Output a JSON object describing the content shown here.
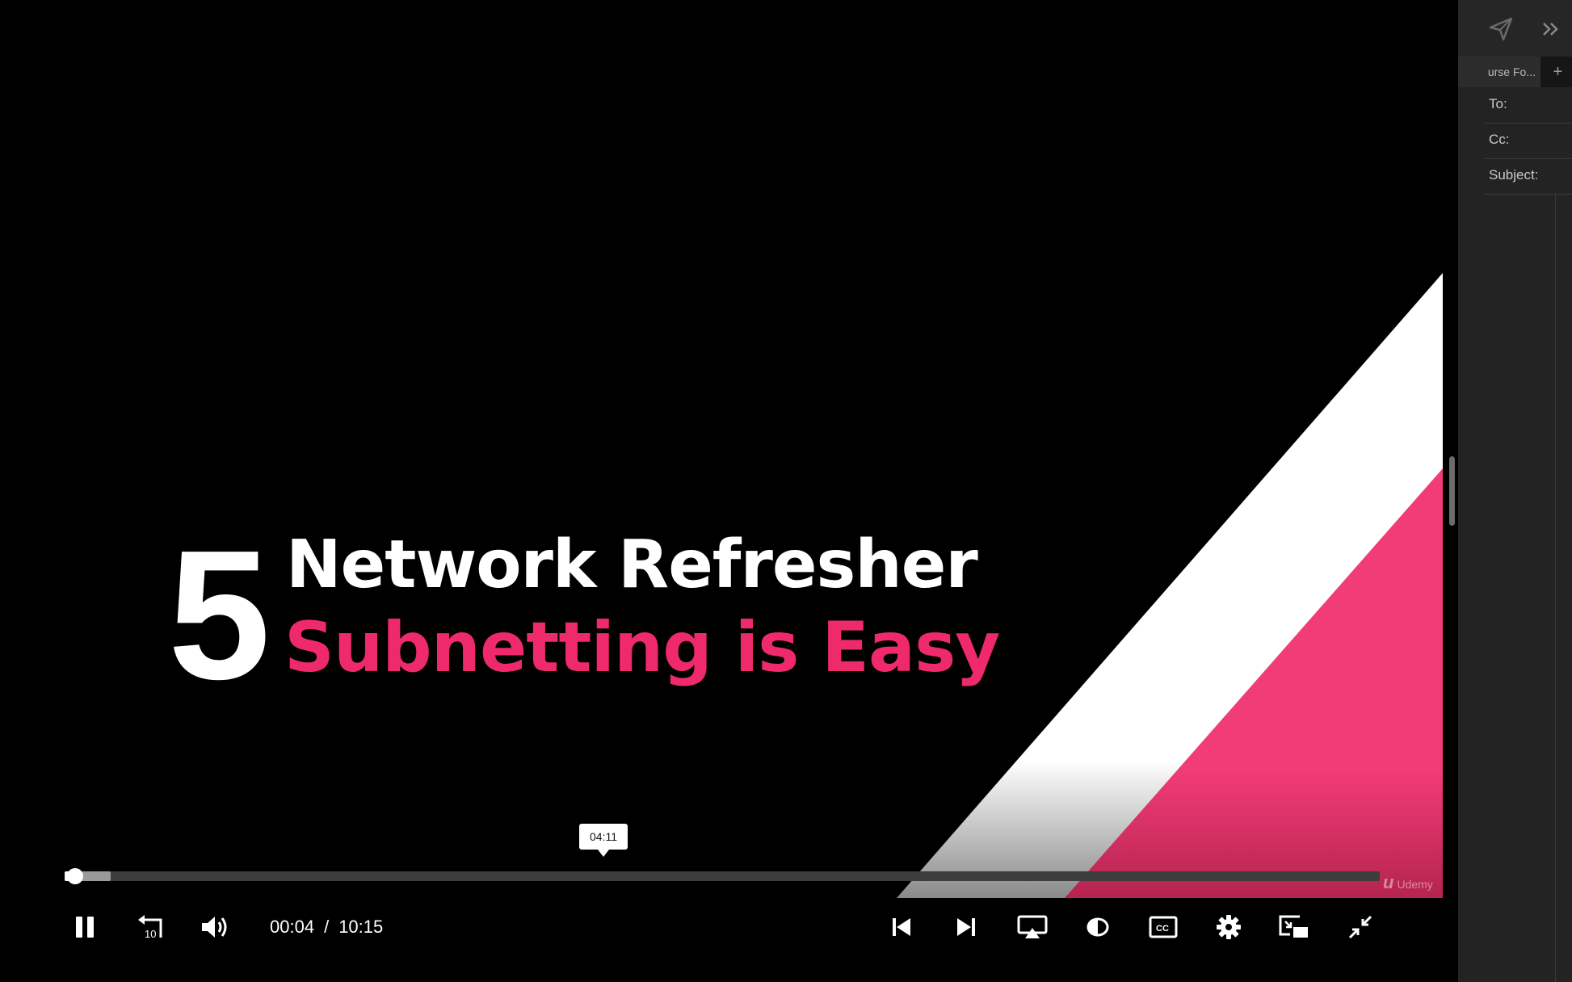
{
  "video": {
    "slide_number": "5",
    "title_line1": "Network Refresher",
    "title_line2": "Subnetting is Easy",
    "watermark": "Udemy",
    "hover_time": "04:11",
    "current_time": "00:04",
    "separator": "/",
    "duration": "10:15",
    "progress_played": 0.007,
    "progress_buffered": 0.035,
    "skip_back_seconds": "10",
    "cc_label": "CC"
  },
  "colors": {
    "accent_pink": "#ee2a6b",
    "background": "#000000",
    "panel_bg": "#232323"
  },
  "controls": {
    "left": [
      "pause-icon",
      "rewind-10-icon",
      "volume-icon"
    ],
    "right": [
      "previous-icon",
      "next-icon",
      "airplay-icon",
      "theater-mode-icon",
      "captions-icon",
      "settings-icon",
      "picture-in-picture-icon",
      "exit-fullscreen-icon"
    ]
  },
  "email_panel": {
    "tab_label": "urse Fo...",
    "add_tab": "+",
    "to_label": "To:",
    "cc_label": "Cc:",
    "subject_label": "Subject:"
  }
}
